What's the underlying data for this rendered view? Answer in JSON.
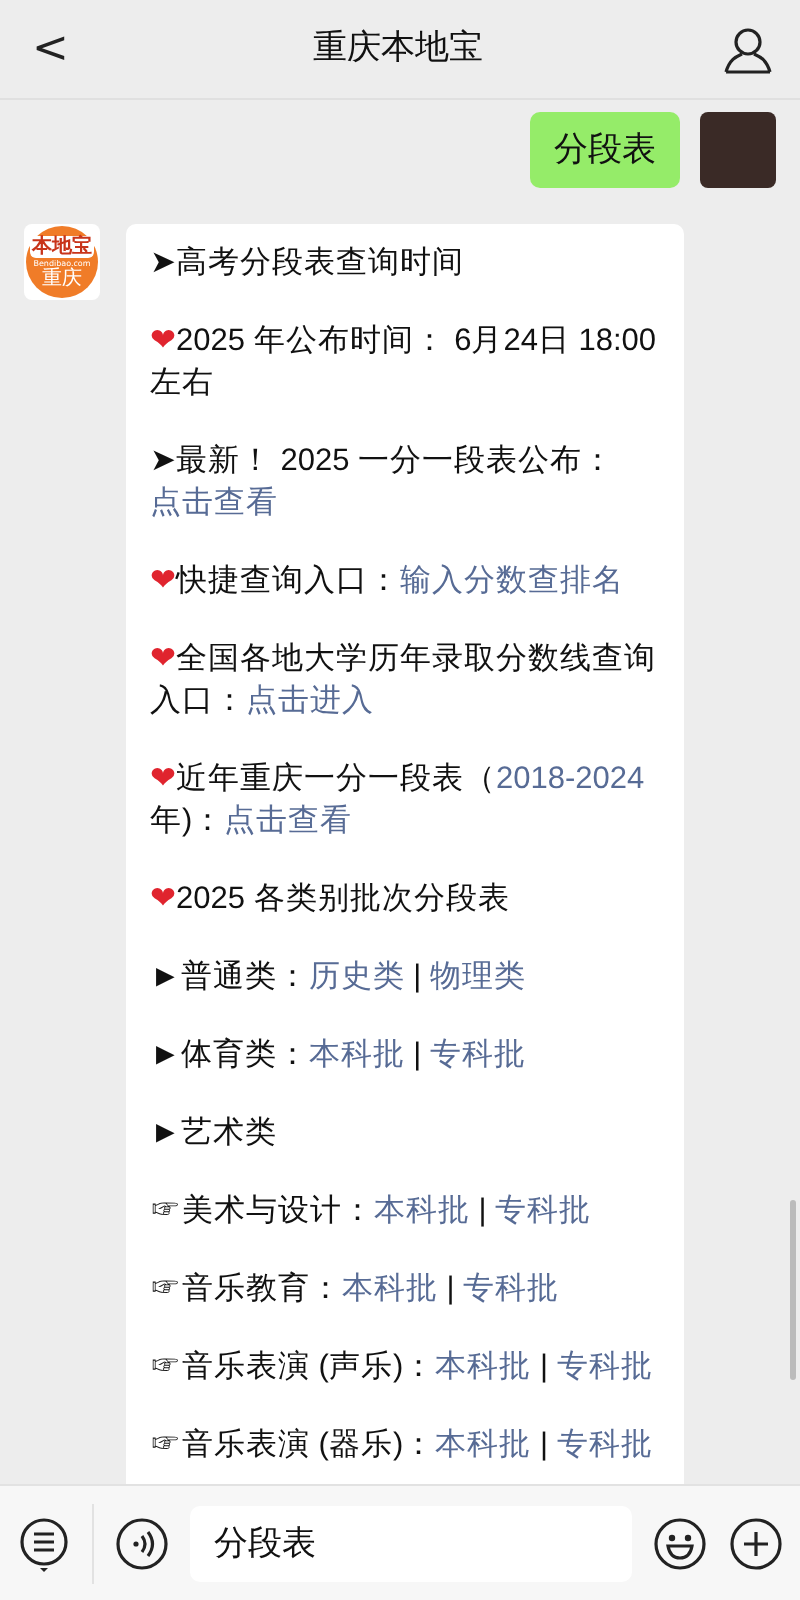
{
  "header": {
    "back": "<",
    "title": "重庆本地宝"
  },
  "messages": [
    {
      "kind": "outgoing",
      "text": "分段表"
    },
    {
      "kind": "incoming",
      "logo": {
        "top": "本地宝",
        "site": "Bendibao.com",
        "bottom": "重庆"
      },
      "paragraphs": [
        {
          "kind": "arrow",
          "marker": "➤",
          "segments": [
            {
              "text": "高考分段表查询时间",
              "link": false
            }
          ]
        },
        {
          "kind": "heart",
          "marker": "❤",
          "segments": [
            {
              "text": "2025 年公布时间：  6月24日 18:00 左右",
              "link": false
            }
          ]
        },
        {
          "kind": "arrow",
          "marker": "➤",
          "segments": [
            {
              "text": "最新！ 2025 一分一段表公布：",
              "link": false
            },
            {
              "text": "点击查看",
              "link": true
            }
          ]
        },
        {
          "kind": "heart",
          "marker": "❤",
          "segments": [
            {
              "text": "快捷查询入口：",
              "link": false
            },
            {
              "text": "输入分数查排名",
              "link": true
            }
          ]
        },
        {
          "kind": "heart",
          "marker": "❤",
          "segments": [
            {
              "text": "全国各地大学历年录取分数线查询入口：",
              "link": false
            },
            {
              "text": "点击进入",
              "link": true
            }
          ]
        },
        {
          "kind": "heart",
          "marker": "❤",
          "segments": [
            {
              "text": "近年重庆一分一段表（",
              "link": false
            },
            {
              "text": "2018-2024",
              "link": true
            },
            {
              "text": "年)：",
              "link": false
            },
            {
              "text": "点击查看",
              "link": true
            }
          ]
        },
        {
          "kind": "heart",
          "marker": "❤",
          "segments": [
            {
              "text": "2025 各类别批次分段表",
              "link": false
            }
          ]
        },
        {
          "kind": "triangle",
          "marker": "►",
          "segments": [
            {
              "text": "普通类：",
              "link": false
            },
            {
              "text": "历史类",
              "link": true
            },
            {
              "text": " | ",
              "link": false
            },
            {
              "text": "物理类",
              "link": true
            }
          ]
        },
        {
          "kind": "triangle",
          "marker": "►",
          "segments": [
            {
              "text": "体育类：",
              "link": false
            },
            {
              "text": "本科批",
              "link": true
            },
            {
              "text": " | ",
              "link": false
            },
            {
              "text": "专科批",
              "link": true
            }
          ]
        },
        {
          "kind": "triangle",
          "marker": "►",
          "segments": [
            {
              "text": "艺术类",
              "link": false
            }
          ]
        },
        {
          "kind": "pointer",
          "marker": "☞",
          "segments": [
            {
              "text": "美术与设计：",
              "link": false
            },
            {
              "text": "本科批",
              "link": true
            },
            {
              "text": " | ",
              "link": false
            },
            {
              "text": "专科批",
              "link": true
            }
          ]
        },
        {
          "kind": "pointer",
          "marker": "☞",
          "segments": [
            {
              "text": "音乐教育：",
              "link": false
            },
            {
              "text": "本科批",
              "link": true
            },
            {
              "text": " | ",
              "link": false
            },
            {
              "text": "专科批",
              "link": true
            }
          ]
        },
        {
          "kind": "pointer",
          "marker": "☞",
          "segments": [
            {
              "text": "音乐表演 (声乐)：",
              "link": false
            },
            {
              "text": "本科批",
              "link": true
            },
            {
              "text": " | ",
              "link": false
            },
            {
              "text": "专科批",
              "link": true
            }
          ]
        },
        {
          "kind": "pointer",
          "marker": "☞",
          "segments": [
            {
              "text": "音乐表演 (器乐)：",
              "link": false
            },
            {
              "text": "本科批",
              "link": true
            },
            {
              "text": " | ",
              "link": false
            },
            {
              "text": "专科批",
              "link": true
            }
          ]
        }
      ]
    }
  ],
  "input": {
    "value": "分段表"
  }
}
